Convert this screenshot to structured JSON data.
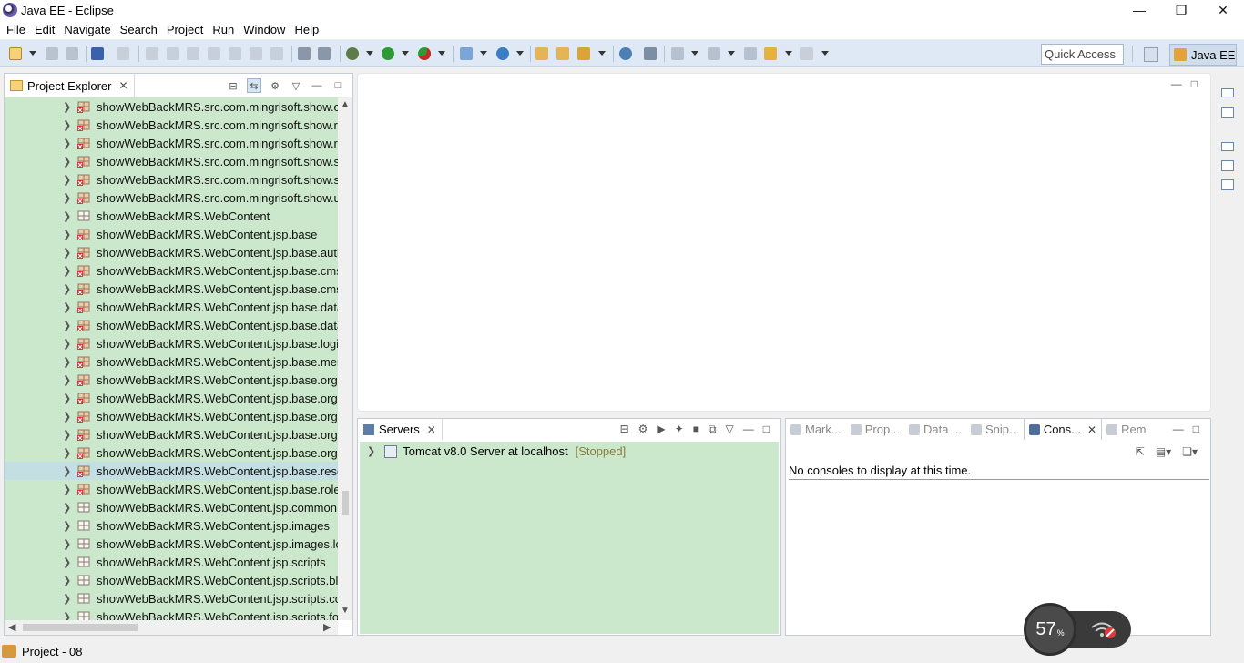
{
  "window": {
    "title": "Java EE - Eclipse"
  },
  "menu": [
    "File",
    "Edit",
    "Navigate",
    "Search",
    "Project",
    "Run",
    "Window",
    "Help"
  ],
  "toolbar": {
    "quick_access_placeholder": "Quick Access",
    "perspective_label": "Java EE"
  },
  "project_explorer": {
    "tab_label": "Project Explorer",
    "items": [
      "showWebBackMRS.src.com.mingrisoft.show.c",
      "showWebBackMRS.src.com.mingrisoft.show.r",
      "showWebBackMRS.src.com.mingrisoft.show.r",
      "showWebBackMRS.src.com.mingrisoft.show.s",
      "showWebBackMRS.src.com.mingrisoft.show.s",
      "showWebBackMRS.src.com.mingrisoft.show.u",
      "showWebBackMRS.WebContent",
      "showWebBackMRS.WebContent.jsp.base",
      "showWebBackMRS.WebContent.jsp.base.auth",
      "showWebBackMRS.WebContent.jsp.base.cms",
      "showWebBackMRS.WebContent.jsp.base.cms",
      "showWebBackMRS.WebContent.jsp.base.data",
      "showWebBackMRS.WebContent.jsp.base.data",
      "showWebBackMRS.WebContent.jsp.base.logi",
      "showWebBackMRS.WebContent.jsp.base.mer",
      "showWebBackMRS.WebContent.jsp.base.org",
      "showWebBackMRS.WebContent.jsp.base.org",
      "showWebBackMRS.WebContent.jsp.base.org",
      "showWebBackMRS.WebContent.jsp.base.org",
      "showWebBackMRS.WebContent.jsp.base.org",
      "showWebBackMRS.WebContent.jsp.base.reso",
      "showWebBackMRS.WebContent.jsp.base.role",
      "showWebBackMRS.WebContent.jsp.common",
      "showWebBackMRS.WebContent.jsp.images",
      "showWebBackMRS.WebContent.jsp.images.lo",
      "showWebBackMRS.WebContent.jsp.scripts",
      "showWebBackMRS.WebContent.jsp.scripts.bl",
      "showWebBackMRS.WebContent.jsp.scripts.co",
      "showWebBackMRS.WebContent.jsp.scripts.fo"
    ],
    "error_items": [
      0,
      1,
      2,
      3,
      4,
      5,
      7,
      8,
      9,
      10,
      11,
      12,
      13,
      14,
      15,
      16,
      17,
      18,
      19,
      20,
      21
    ],
    "selected_index": 20
  },
  "servers": {
    "tab_label": "Servers",
    "server_name": "Tomcat v8.0 Server at localhost",
    "server_status": "[Stopped]"
  },
  "console_panel": {
    "tabs": [
      {
        "label": "Mark...",
        "active": false
      },
      {
        "label": "Prop...",
        "active": false
      },
      {
        "label": "Data ...",
        "active": false
      },
      {
        "label": "Snip...",
        "active": false
      },
      {
        "label": "Cons...",
        "active": true
      },
      {
        "label": "Rem",
        "active": false
      }
    ],
    "message": "No consoles to display at this time."
  },
  "status_bar": {
    "project_label": "Project - 08"
  },
  "widget": {
    "percent": "57",
    "unit": "%"
  },
  "colors": {
    "tree_bg": "#cce8cc",
    "toolbar_bg": "#dfe9f5",
    "error_red": "#d62b2b"
  }
}
